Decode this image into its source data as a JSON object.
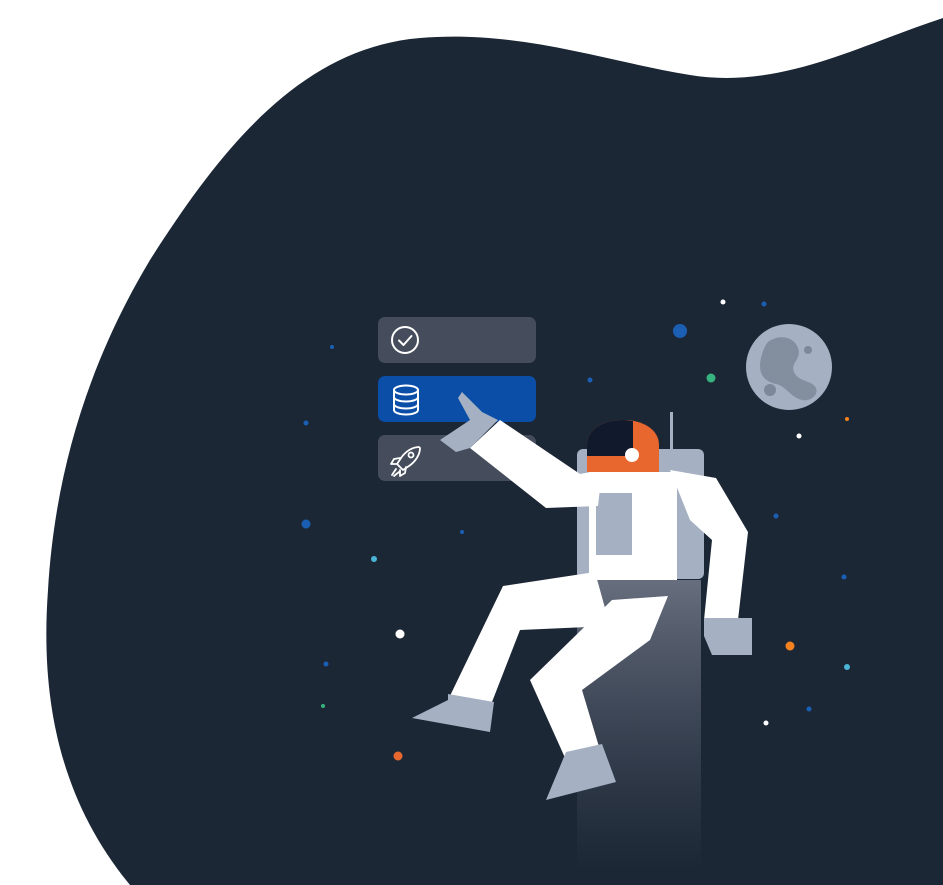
{
  "colors": {
    "page_background": "#ffffff",
    "blob": "#1c2736",
    "menu_item": "#454d5c",
    "menu_item_active": "#0a4ea8",
    "suit": "#ffffff",
    "suit_accent": "#a5b1c2",
    "helmet": "#e8672e",
    "visor": "#111a2c",
    "moon": "#a5b1c2",
    "moon_crater": "#7d8899",
    "star_white": "#ffffff",
    "star_blue": "#1a5fb4",
    "star_green": "#36b37e",
    "star_orange": "#f58220",
    "star_red": "#e8672e",
    "star_teal": "#4ab5d6"
  },
  "menu_items": [
    {
      "icon": "check-circle-icon",
      "active": false
    },
    {
      "icon": "database-icon",
      "active": true
    },
    {
      "icon": "rocket-icon",
      "active": false
    }
  ]
}
